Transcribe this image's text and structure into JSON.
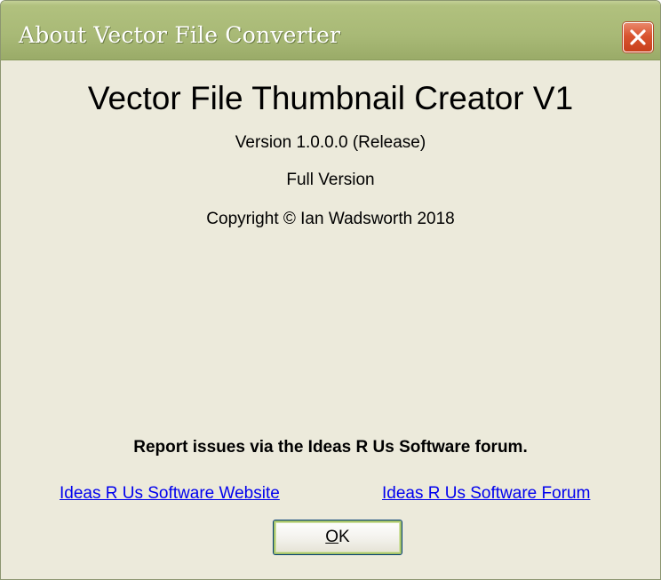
{
  "window": {
    "title": "About Vector File Converter",
    "close_icon": "close-icon"
  },
  "about": {
    "app_title": "Vector File Thumbnail Creator V1",
    "version": "Version 1.0.0.0 (Release)",
    "edition": "Full Version",
    "copyright": "Copyright © Ian Wadsworth 2018",
    "report_text": "Report issues via the Ideas R Us Software forum."
  },
  "links": {
    "website": "Ideas R Us Software Website",
    "forum": "Ideas R Us Software Forum"
  },
  "buttons": {
    "ok_mnemonic": "O",
    "ok_rest": "K"
  },
  "colors": {
    "titlebar": "#a8b976",
    "client_bg": "#eceadb",
    "link": "#0000ee",
    "close_button": "#d9542f"
  }
}
